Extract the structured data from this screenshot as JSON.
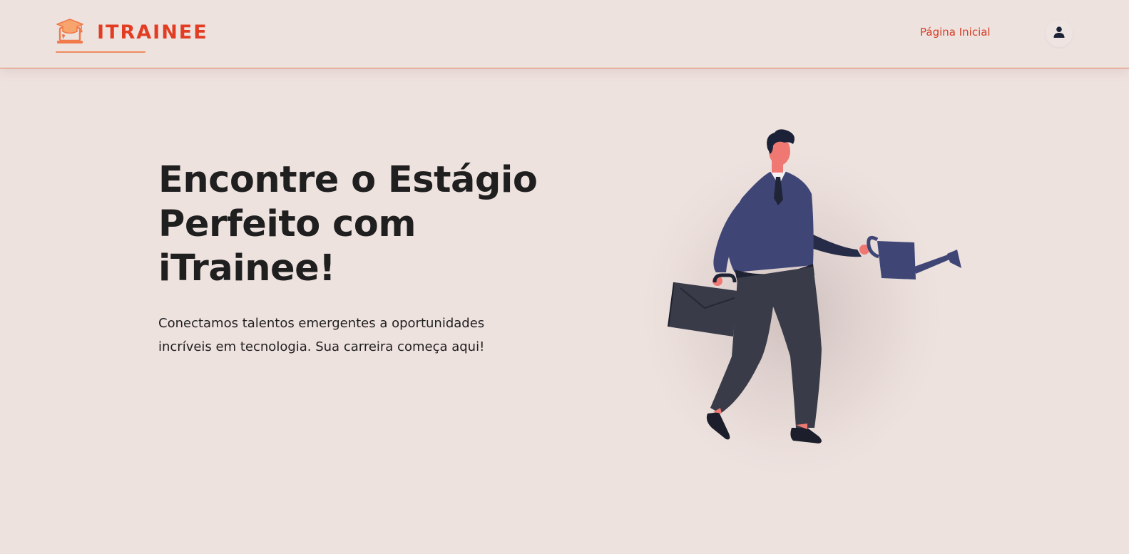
{
  "header": {
    "brand_name": "ITRAINEE",
    "brand_icon": "graduation-cap-laptop-icon",
    "nav_home": "Página Inicial",
    "user_icon": "user-icon"
  },
  "hero": {
    "title": "Encontre o Estágio Perfeito com iTrainee!",
    "text_line1": "Conectamos talentos emergentes a oportunidades",
    "text_line2": "incríveis em tecnologia. Sua carreira começa aqui!"
  },
  "colors": {
    "background": "#eee2df",
    "brand": "#e23d22",
    "accent": "#f08a5d",
    "text": "#1f1f1f"
  }
}
